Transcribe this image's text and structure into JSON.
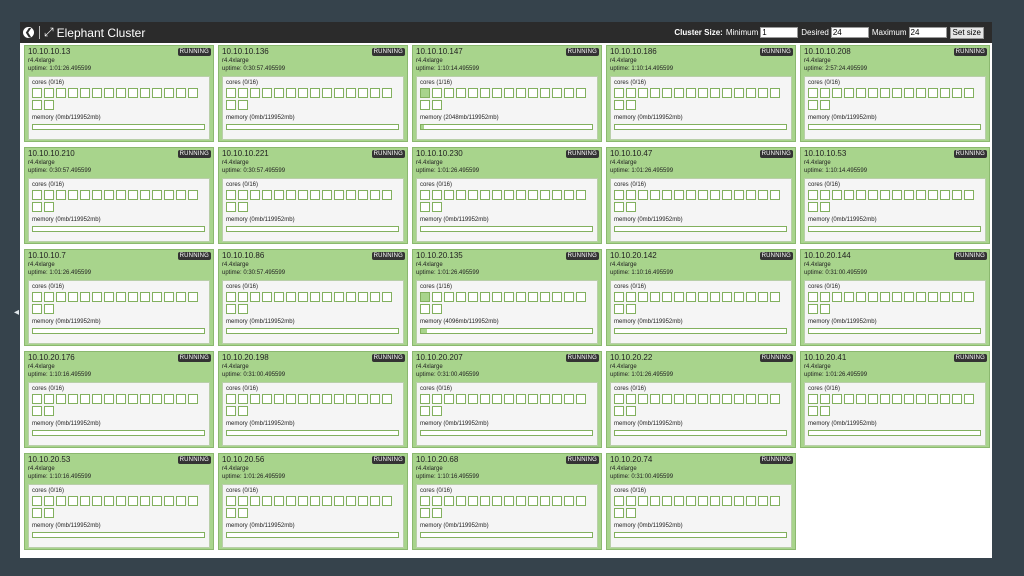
{
  "app": {
    "title": "Elephant Cluster",
    "cluster_size_label": "Cluster Size:",
    "minimum_label": "Minimum",
    "minimum_value": "1",
    "desired_label": "Desired",
    "desired_value": "24",
    "maximum_label": "Maximum",
    "maximum_value": "24",
    "set_size_label": "Set size"
  },
  "colors": {
    "node_background": "#a8d48c",
    "topbar": "#2b2b2b",
    "page_background": "#36434c"
  },
  "total_cores": 16,
  "total_memory_mb": 119952,
  "nodes": [
    {
      "ip": "10.10.10.13",
      "status": "RUNNING",
      "type": "r4.4xlarge",
      "uptime": "uptime: 1:01:26.495599",
      "cores_text": "cores (0/16)",
      "cores_used": 0,
      "memory_text": "memory (0mb/119952mb)",
      "memory_used_mb": 0
    },
    {
      "ip": "10.10.10.136",
      "status": "RUNNING",
      "type": "r4.4xlarge",
      "uptime": "uptime: 0:30:57.495599",
      "cores_text": "cores (0/16)",
      "cores_used": 0,
      "memory_text": "memory (0mb/119952mb)",
      "memory_used_mb": 0
    },
    {
      "ip": "10.10.10.147",
      "status": "RUNNING",
      "type": "r4.4xlarge",
      "uptime": "uptime: 1:10:14.495599",
      "cores_text": "cores (1/16)",
      "cores_used": 1,
      "memory_text": "memory (2048mb/119952mb)",
      "memory_used_mb": 2048
    },
    {
      "ip": "10.10.10.186",
      "status": "RUNNING",
      "type": "r4.4xlarge",
      "uptime": "uptime: 1:10:14.495599",
      "cores_text": "cores (0/16)",
      "cores_used": 0,
      "memory_text": "memory (0mb/119952mb)",
      "memory_used_mb": 0
    },
    {
      "ip": "10.10.10.208",
      "status": "RUNNING",
      "type": "r4.4xlarge",
      "uptime": "uptime: 2:57:24.495599",
      "cores_text": "cores (0/16)",
      "cores_used": 0,
      "memory_text": "memory (0mb/119952mb)",
      "memory_used_mb": 0
    },
    {
      "ip": "10.10.10.210",
      "status": "RUNNING",
      "type": "r4.4xlarge",
      "uptime": "uptime: 0:30:57.495599",
      "cores_text": "cores (0/16)",
      "cores_used": 0,
      "memory_text": "memory (0mb/119952mb)",
      "memory_used_mb": 0
    },
    {
      "ip": "10.10.10.221",
      "status": "RUNNING",
      "type": "r4.4xlarge",
      "uptime": "uptime: 0:30:57.495599",
      "cores_text": "cores (0/16)",
      "cores_used": 0,
      "memory_text": "memory (0mb/119952mb)",
      "memory_used_mb": 0
    },
    {
      "ip": "10.10.10.230",
      "status": "RUNNING",
      "type": "r4.4xlarge",
      "uptime": "uptime: 1:01:26.495599",
      "cores_text": "cores (0/16)",
      "cores_used": 0,
      "memory_text": "memory (0mb/119952mb)",
      "memory_used_mb": 0
    },
    {
      "ip": "10.10.10.47",
      "status": "RUNNING",
      "type": "r4.4xlarge",
      "uptime": "uptime: 1:01:26.495599",
      "cores_text": "cores (0/16)",
      "cores_used": 0,
      "memory_text": "memory (0mb/119952mb)",
      "memory_used_mb": 0
    },
    {
      "ip": "10.10.10.53",
      "status": "RUNNING",
      "type": "r4.4xlarge",
      "uptime": "uptime: 1:10:14.495599",
      "cores_text": "cores (0/16)",
      "cores_used": 0,
      "memory_text": "memory (0mb/119952mb)",
      "memory_used_mb": 0
    },
    {
      "ip": "10.10.10.7",
      "status": "RUNNING",
      "type": "r4.4xlarge",
      "uptime": "uptime: 1:01:26.495599",
      "cores_text": "cores (0/16)",
      "cores_used": 0,
      "memory_text": "memory (0mb/119952mb)",
      "memory_used_mb": 0
    },
    {
      "ip": "10.10.10.86",
      "status": "RUNNING",
      "type": "r4.4xlarge",
      "uptime": "uptime: 0:30:57.495599",
      "cores_text": "cores (0/16)",
      "cores_used": 0,
      "memory_text": "memory (0mb/119952mb)",
      "memory_used_mb": 0
    },
    {
      "ip": "10.10.20.135",
      "status": "RUNNING",
      "type": "r4.4xlarge",
      "uptime": "uptime: 1:01:26.495599",
      "cores_text": "cores (1/16)",
      "cores_used": 1,
      "memory_text": "memory (4096mb/119952mb)",
      "memory_used_mb": 4096
    },
    {
      "ip": "10.10.20.142",
      "status": "RUNNING",
      "type": "r4.4xlarge",
      "uptime": "uptime: 1:10:16.495599",
      "cores_text": "cores (0/16)",
      "cores_used": 0,
      "memory_text": "memory (0mb/119952mb)",
      "memory_used_mb": 0
    },
    {
      "ip": "10.10.20.144",
      "status": "RUNNING",
      "type": "r4.4xlarge",
      "uptime": "uptime: 0:31:00.495599",
      "cores_text": "cores (0/16)",
      "cores_used": 0,
      "memory_text": "memory (0mb/119952mb)",
      "memory_used_mb": 0
    },
    {
      "ip": "10.10.20.176",
      "status": "RUNNING",
      "type": "r4.4xlarge",
      "uptime": "uptime: 1:10:16.495599",
      "cores_text": "cores (0/16)",
      "cores_used": 0,
      "memory_text": "memory (0mb/119952mb)",
      "memory_used_mb": 0
    },
    {
      "ip": "10.10.20.198",
      "status": "RUNNING",
      "type": "r4.4xlarge",
      "uptime": "uptime: 0:31:00.495599",
      "cores_text": "cores (0/16)",
      "cores_used": 0,
      "memory_text": "memory (0mb/119952mb)",
      "memory_used_mb": 0
    },
    {
      "ip": "10.10.20.207",
      "status": "RUNNING",
      "type": "r4.4xlarge",
      "uptime": "uptime: 0:31:00.495599",
      "cores_text": "cores (0/16)",
      "cores_used": 0,
      "memory_text": "memory (0mb/119952mb)",
      "memory_used_mb": 0
    },
    {
      "ip": "10.10.20.22",
      "status": "RUNNING",
      "type": "r4.4xlarge",
      "uptime": "uptime: 1:01:26.495599",
      "cores_text": "cores (0/16)",
      "cores_used": 0,
      "memory_text": "memory (0mb/119952mb)",
      "memory_used_mb": 0
    },
    {
      "ip": "10.10.20.41",
      "status": "RUNNING",
      "type": "r4.4xlarge",
      "uptime": "uptime: 1:01:26.495599",
      "cores_text": "cores (0/16)",
      "cores_used": 0,
      "memory_text": "memory (0mb/119952mb)",
      "memory_used_mb": 0
    },
    {
      "ip": "10.10.20.53",
      "status": "RUNNING",
      "type": "r4.4xlarge",
      "uptime": "uptime: 1:10:16.495599",
      "cores_text": "cores (0/16)",
      "cores_used": 0,
      "memory_text": "memory (0mb/119952mb)",
      "memory_used_mb": 0
    },
    {
      "ip": "10.10.20.56",
      "status": "RUNNING",
      "type": "r4.4xlarge",
      "uptime": "uptime: 1:01:26.495599",
      "cores_text": "cores (0/16)",
      "cores_used": 0,
      "memory_text": "memory (0mb/119952mb)",
      "memory_used_mb": 0
    },
    {
      "ip": "10.10.20.68",
      "status": "RUNNING",
      "type": "r4.4xlarge",
      "uptime": "uptime: 1:10:16.495599",
      "cores_text": "cores (0/16)",
      "cores_used": 0,
      "memory_text": "memory (0mb/119952mb)",
      "memory_used_mb": 0
    },
    {
      "ip": "10.10.20.74",
      "status": "RUNNING",
      "type": "r4.4xlarge",
      "uptime": "uptime: 0:31:00.495599",
      "cores_text": "cores (0/16)",
      "cores_used": 0,
      "memory_text": "memory (0mb/119952mb)",
      "memory_used_mb": 0
    }
  ]
}
